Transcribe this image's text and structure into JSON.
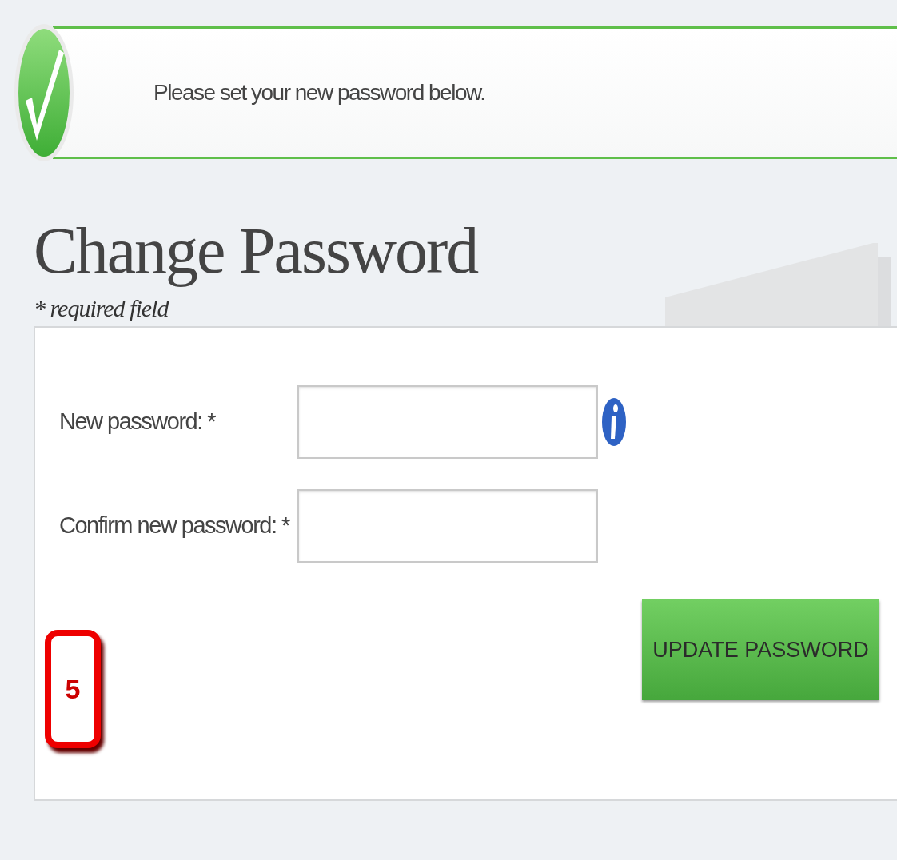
{
  "notice": {
    "message": "Please set your new password below."
  },
  "heading": {
    "title": "Change Password",
    "note": "* required field"
  },
  "form": {
    "fields": [
      {
        "label": "New password: *",
        "kind": "info"
      },
      {
        "label": "Confirm new password: *",
        "kind": "plain"
      }
    ],
    "submit": "UPDATE PASSWORD",
    "step_badge": "5"
  }
}
